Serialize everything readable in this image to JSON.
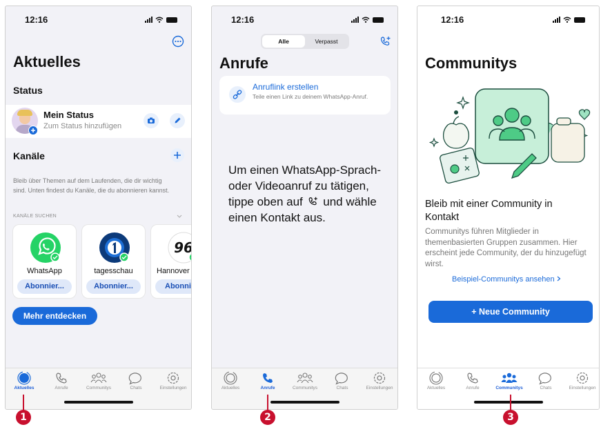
{
  "colors": {
    "accent": "#1a6ad9",
    "marker": "#c8102e",
    "whatsapp": "#25d366"
  },
  "screens": [
    {
      "time": "12:16",
      "title": "Aktuelles",
      "status_heading": "Status",
      "my_status_name": "Mein Status",
      "my_status_hint": "Zum Status hinzufügen",
      "channels_heading": "Kanäle",
      "channels_desc": "Bleib über Themen auf dem Laufenden, die dir wichtig sind. Unten findest du Kanäle, die du abonnieren kannst.",
      "search_label": "KANÄLE SUCHEN",
      "channels": [
        {
          "name": "WhatsApp",
          "button": "Abonnier..."
        },
        {
          "name": "tagesschau",
          "button": "Abonnier..."
        },
        {
          "name": "Hannover",
          "button": "Abonnie"
        }
      ],
      "discover_button": "Mehr entdecken",
      "marker": "1"
    },
    {
      "time": "12:16",
      "segments": [
        "Alle",
        "Verpasst"
      ],
      "title": "Anrufe",
      "link_title": "Anruflink erstellen",
      "link_desc": "Teile einen Link zu deinem WhatsApp-Anruf.",
      "empty_text_1": "Um einen WhatsApp-Sprach- oder Videoanruf zu tätigen, tippe oben auf",
      "empty_text_2": "und wähle einen Kontakt aus.",
      "marker": "2"
    },
    {
      "time": "12:16",
      "title": "Communitys",
      "heading": "Bleib mit einer Community in Kontakt",
      "desc": "Communitys führen Mitglieder in themenbasierten Gruppen zusammen. Hier erscheint jede Community, der du hinzugefügt wirst.",
      "examples_link": "Beispiel-Communitys ansehen",
      "new_button": "+ Neue Community",
      "marker": "3"
    }
  ],
  "tabs": [
    "Aktuelles",
    "Anrufe",
    "Communitys",
    "Chats",
    "Einstellungen"
  ]
}
